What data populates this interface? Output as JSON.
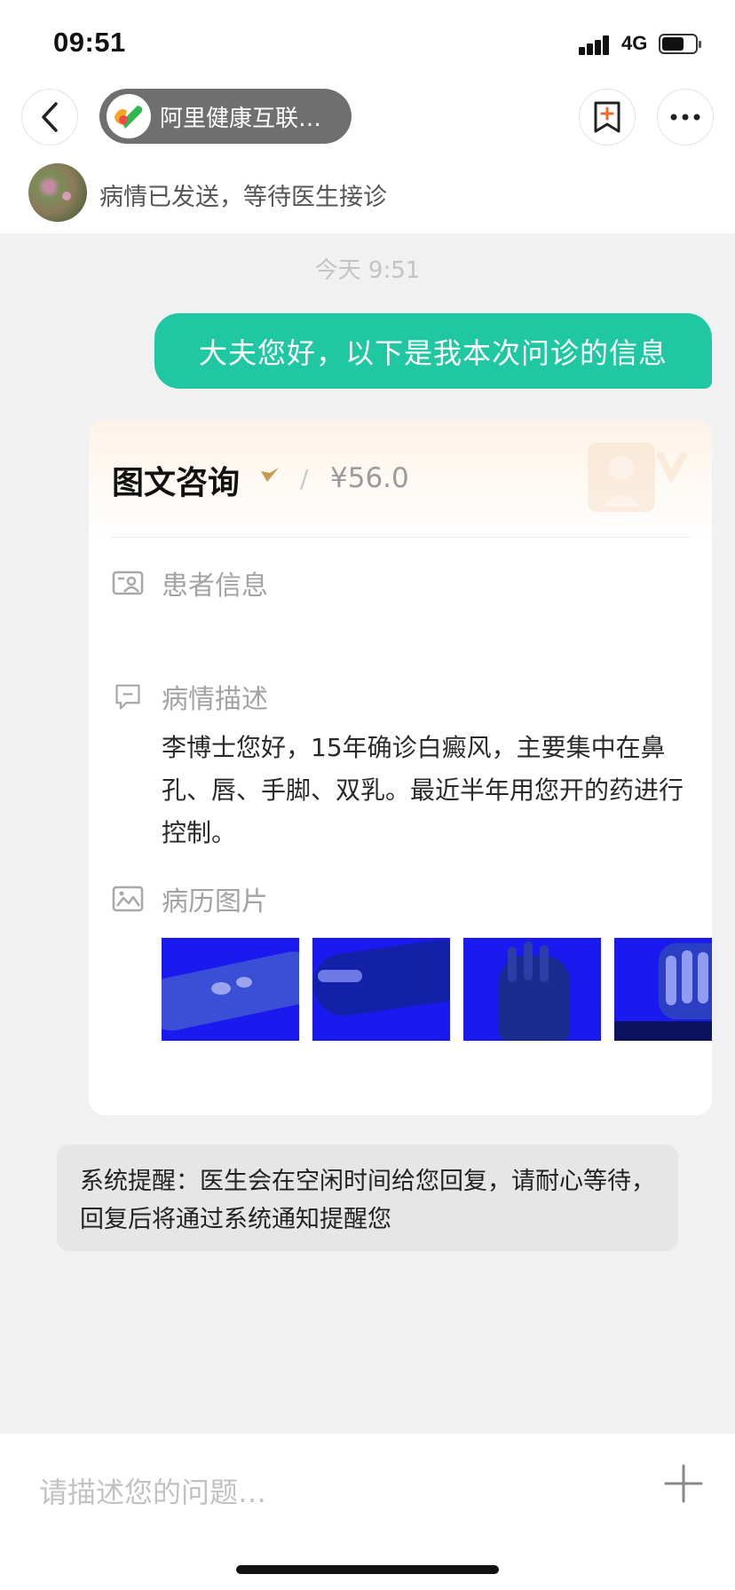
{
  "status_bar": {
    "time": "09:51",
    "network": "4G"
  },
  "header": {
    "app_name": "阿里健康互联…",
    "status_text": "病情已发送，等待医生接诊",
    "icons": [
      "back-icon",
      "app-logo-icon",
      "bookmark-add-icon",
      "more-icon"
    ]
  },
  "chat": {
    "timestamp": "今天 9:51",
    "outgoing_message": "大夫您好，以下是我本次问诊的信息"
  },
  "card": {
    "title": "图文咨询",
    "separator": "/",
    "price": "¥56.0",
    "patient_info_label": "患者信息",
    "condition_label": "病情描述",
    "condition_text": "李博士您好，15年确诊白癜风，主要集中在鼻孔、唇、手脚、双乳。最近半年用您开的药进行控制。",
    "history_images_label": "病历图片",
    "images": [
      "history-image-1",
      "history-image-2",
      "history-image-3",
      "history-image-4"
    ]
  },
  "notice": {
    "text": "系统提醒：医生会在空闲时间给您回复，请耐心等待，回复后将通过系统通知提醒您"
  },
  "input": {
    "placeholder": "请描述您的问题…"
  },
  "colors": {
    "accent": "#1fc8a3",
    "pill": "#6f6f6f",
    "background": "#f1f1f1"
  }
}
